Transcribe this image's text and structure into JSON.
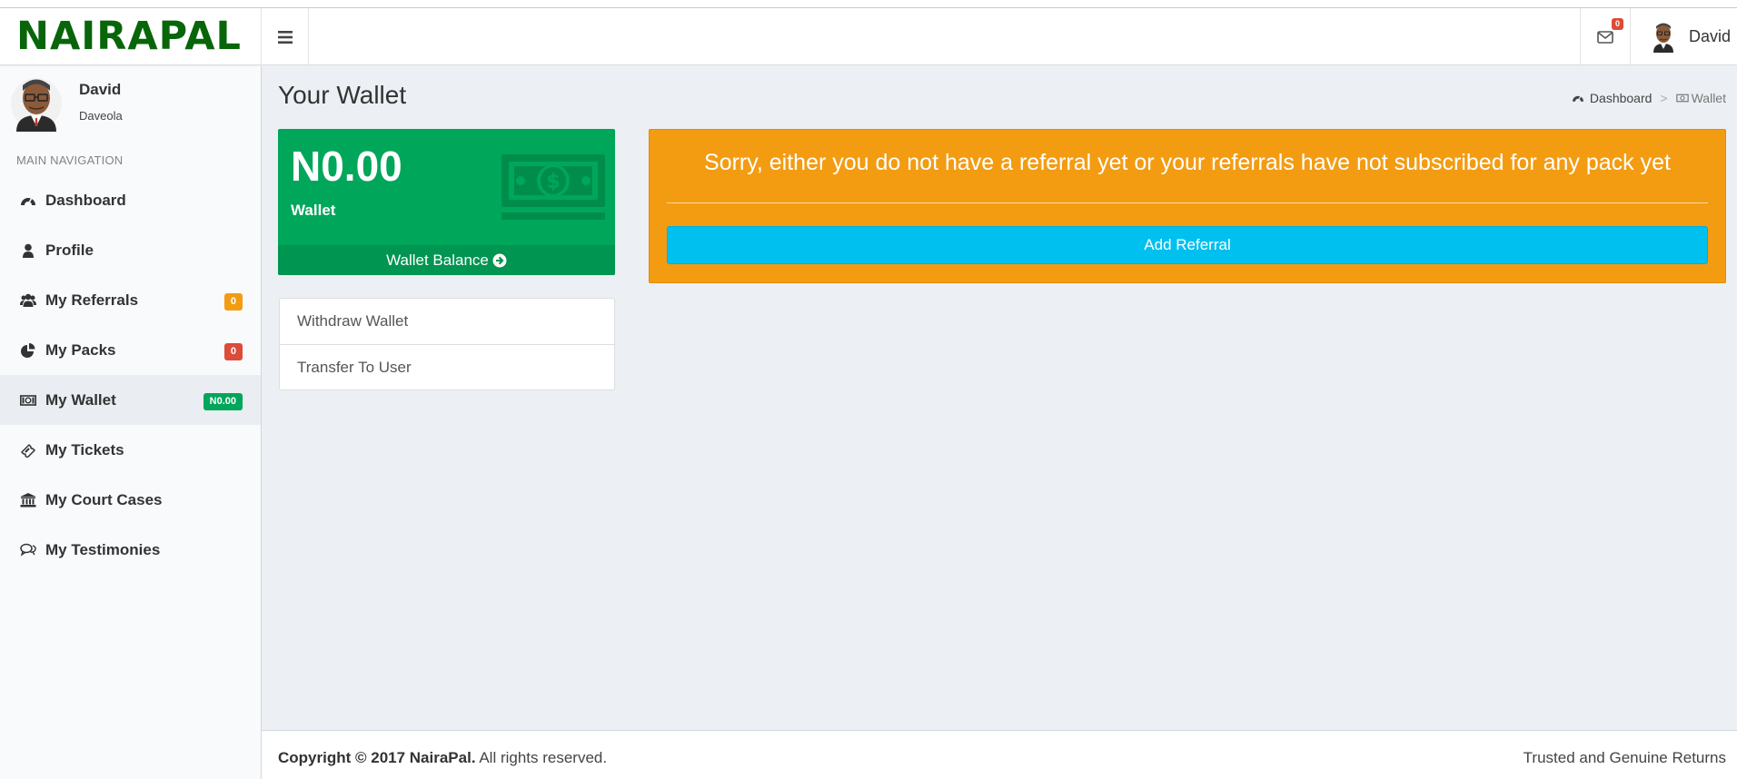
{
  "brand": {
    "logo_text": "NAIRAPAL",
    "logo_color": "#08650a"
  },
  "header": {
    "mail_count": "0",
    "user_name": "David"
  },
  "sidebar": {
    "user_name": "David",
    "user_sub": "Daveola",
    "nav_header": "MAIN NAVIGATION",
    "items": [
      {
        "label": "Dashboard",
        "icon": "dashboard-icon"
      },
      {
        "label": "Profile",
        "icon": "user-icon"
      },
      {
        "label": "My Referrals",
        "icon": "users-icon",
        "badge": "0",
        "badge_color": "#f39c12"
      },
      {
        "label": "My Packs",
        "icon": "pie-chart-icon",
        "badge": "0",
        "badge_color": "#dd4b39"
      },
      {
        "label": "My Wallet",
        "icon": "money-icon",
        "badge": "N0.00",
        "badge_color": "#00a65a",
        "active": true
      },
      {
        "label": "My Tickets",
        "icon": "ticket-icon"
      },
      {
        "label": "My Court Cases",
        "icon": "bank-icon"
      },
      {
        "label": "My Testimonies",
        "icon": "comments-icon"
      }
    ]
  },
  "page": {
    "title": "Your Wallet",
    "breadcrumb": {
      "home": "Dashboard",
      "separator": ">",
      "current": "Wallet"
    }
  },
  "wallet_box": {
    "amount": "N0.00",
    "label": "Wallet",
    "footer_label": "Wallet Balance",
    "color": "#00a65a"
  },
  "wallet_actions": [
    "Withdraw Wallet",
    "Transfer To User"
  ],
  "alert": {
    "message": "Sorry, either you do not have a referral yet or your referrals have not subscribed for any pack yet",
    "button_label": "Add Referral",
    "color": "#f39c12",
    "button_color": "#00c0ef"
  },
  "footer": {
    "copyright_bold": "Copyright © 2017 NairaPal.",
    "copyright_rest": " All rights reserved.",
    "tagline": "Trusted and Genuine Returns"
  }
}
